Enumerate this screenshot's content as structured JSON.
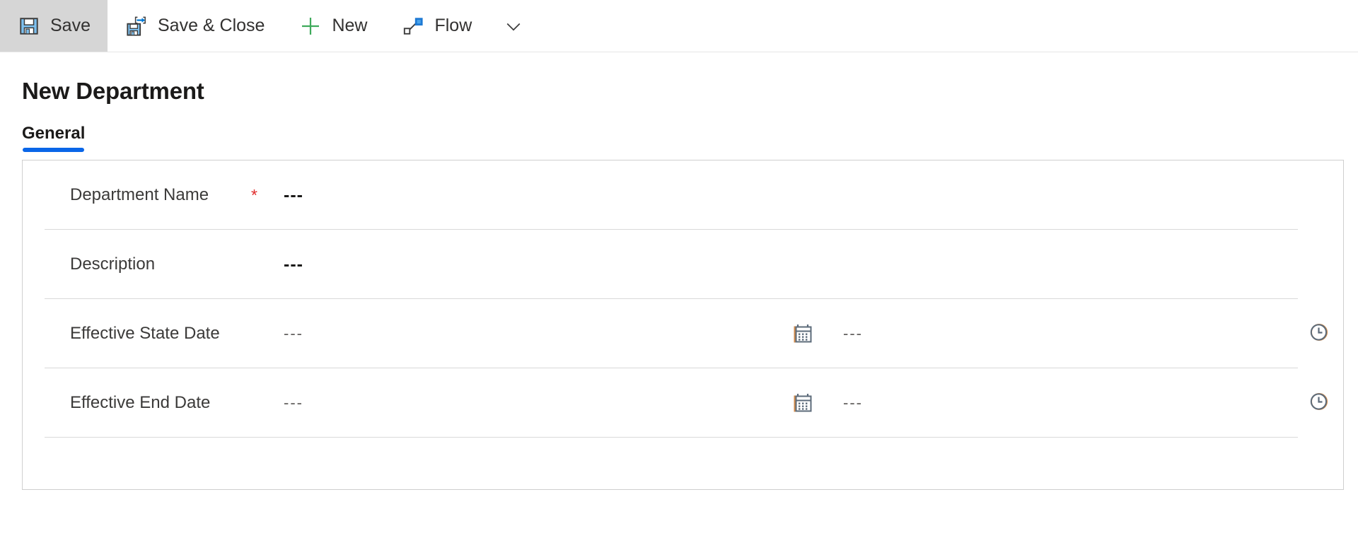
{
  "commandbar": {
    "buttons": [
      {
        "label": "Save",
        "icon": "save-floppy-icon",
        "selected": true
      },
      {
        "label": "Save & Close",
        "icon": "save-and-close-icon",
        "selected": false
      },
      {
        "label": "New",
        "icon": "plus-icon",
        "selected": false
      },
      {
        "label": "Flow",
        "icon": "flow-icon",
        "selected": false
      }
    ],
    "overflow_icon": "chevron-down-icon"
  },
  "page": {
    "title": "New Department"
  },
  "tabs": [
    {
      "label": "General",
      "active": true
    }
  ],
  "form": {
    "rows": [
      {
        "label": "Department Name",
        "required": true,
        "required_marker": "*",
        "value": "---",
        "has_date_controls": false
      },
      {
        "label": "Description",
        "required": false,
        "required_marker": "",
        "value": "---",
        "has_date_controls": false
      },
      {
        "label": "Effective State Date",
        "required": false,
        "required_marker": "",
        "value": "---",
        "has_date_controls": true,
        "time_value": "---",
        "calendar_icon": "calendar-icon",
        "clock_icon": "clock-icon"
      },
      {
        "label": "Effective End Date",
        "required": false,
        "required_marker": "",
        "value": "---",
        "has_date_controls": true,
        "time_value": "---",
        "calendar_icon": "calendar-icon",
        "clock_icon": "clock-icon"
      }
    ]
  },
  "colors": {
    "accent_blue": "#0a66e8",
    "required_red": "#e02b2b",
    "icon_blue": "#0078d4",
    "icon_gray": "#5c5c5c",
    "selected_bg": "#d6d6d6",
    "border": "#cfcfcf"
  }
}
